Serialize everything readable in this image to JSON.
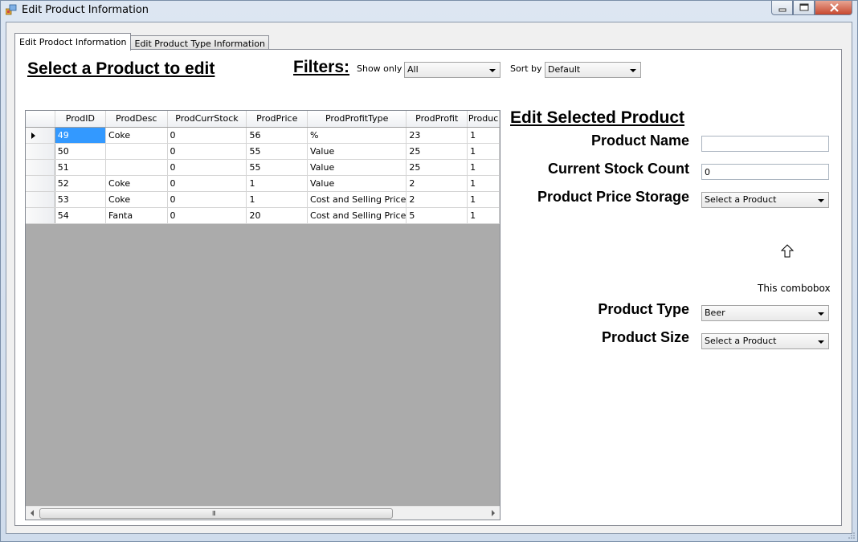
{
  "window": {
    "title": "Edit Product Information",
    "controls": {
      "minimize": "▭",
      "maximize": "▢",
      "close": "✕"
    }
  },
  "tabs": [
    {
      "label": "Edit Prodoct Information",
      "active": true
    },
    {
      "label": "Edit Product Type Information",
      "active": false
    }
  ],
  "left": {
    "heading": "Select a Product to edit",
    "filters": {
      "heading": "Filters:",
      "show_only_label": "Show only",
      "show_only_value": "All",
      "sort_by_label": "Sort by",
      "sort_by_value": "Default"
    }
  },
  "grid": {
    "columns": [
      "ProdID",
      "ProdDesc",
      "ProdCurrStock",
      "ProdPrice",
      "ProdProfitType",
      "ProdProfit",
      "Produc"
    ],
    "rows": [
      [
        "49",
        "Coke",
        "0",
        "56",
        "%",
        "23",
        "1"
      ],
      [
        "50",
        "",
        "0",
        "55",
        "Value",
        "25",
        "1"
      ],
      [
        "51",
        "",
        "0",
        "55",
        "Value",
        "25",
        "1"
      ],
      [
        "52",
        "Coke",
        "0",
        "1",
        "Value",
        "2",
        "1"
      ],
      [
        "53",
        "Coke",
        "0",
        "1",
        "Cost and Selling Price",
        "2",
        "1"
      ],
      [
        "54",
        "Fanta",
        "0",
        "20",
        "Cost and Selling Price",
        "5",
        "1"
      ]
    ],
    "selected_row": 0,
    "scroll_grip": "III"
  },
  "edit": {
    "heading": "Edit Selected Product",
    "product_name_label": "Product Name",
    "product_name_value": "",
    "stock_label": "Current Stock Count",
    "stock_value": "0",
    "price_storage_label": "Product Price Storage",
    "price_storage_value": "Select a Product",
    "annotation": "This combobox",
    "type_label": "Product Type",
    "type_value": "Beer",
    "size_label": "Product Size",
    "size_value": "Select a Product"
  },
  "colors": {
    "selection": "#3399ff",
    "grid_background": "#ababab",
    "close_button": "#c7482f"
  }
}
